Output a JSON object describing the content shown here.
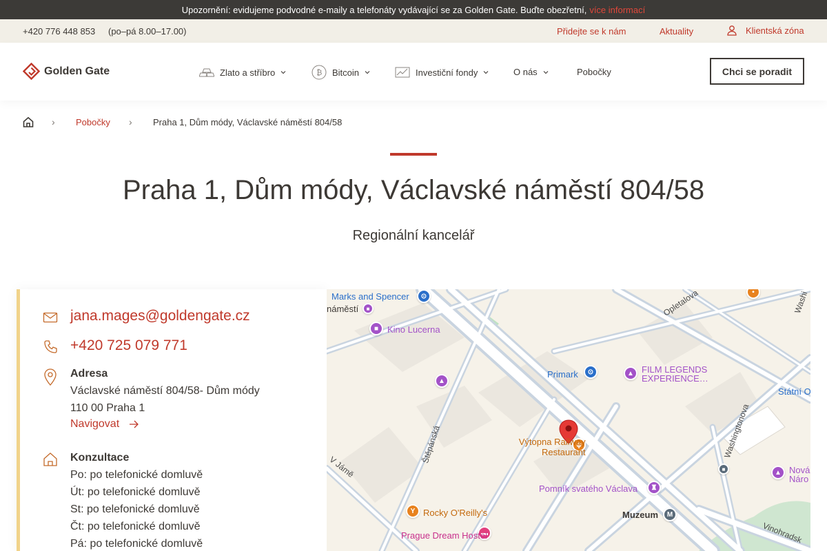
{
  "alert": {
    "text": "Upozornění: evidujeme podvodné e-maily a telefonáty vydávající se za Golden Gate. Buďte obezřetní,",
    "link": "více informací"
  },
  "topbar": {
    "phone": "+420 776 448 853",
    "hours": "(po–pá 8.00–17.00)",
    "join": "Přidejte se k nám",
    "news": "Aktuality",
    "client_zone": "Klientská zóna"
  },
  "header": {
    "logo": "Golden Gate",
    "nav": [
      {
        "label": "Zlato a stříbro"
      },
      {
        "label": "Bitcoin"
      },
      {
        "label": "Investiční fondy"
      },
      {
        "label": "O nás"
      },
      {
        "label": "Pobočky"
      }
    ],
    "cta": "Chci se poradit"
  },
  "breadcrumb": {
    "parent": "Pobočky",
    "current": "Praha 1, Dům módy, Václavské náměstí 804/58"
  },
  "page": {
    "title": "Praha 1, Dům módy, Václavské náměstí 804/58",
    "subtitle": "Regionální kancelář"
  },
  "contact": {
    "email": "jana.mages@goldengate.cz",
    "phone": "+420 725 079 771",
    "address_label": "Adresa",
    "address_line1": "Václavské náměstí 804/58- Dům módy",
    "address_line2": "110 00 Praha 1",
    "navigate": "Navigovat",
    "consult_label": "Konzultace",
    "hours": [
      "Po: po telefonické domluvě",
      "Út: po telefonické domluvě",
      "St: po telefonické domluvě",
      "Čt: po telefonické domluvě",
      "Pá: po telefonické domluvě"
    ]
  },
  "map": {
    "labels": {
      "marks": "Marks and Spencer",
      "namesti": "náměstí",
      "lucerna": "Kino Lucerna",
      "opletalova": "Opletalova",
      "washi": "Washi",
      "primark": "Primark",
      "film1": "FILM LEGENDS",
      "film2": "EXPERIENCE…",
      "statni": "Státní O",
      "vytopna1": "Výtopna Railway",
      "vytopna2": "Restaurant",
      "stepanska": "Štěpánská",
      "vjame": "V Jámě",
      "washingtonova": "Washingtonova",
      "nova1": "Nová",
      "nova2": "Náro",
      "pomnik": "Pomník svatého Václava",
      "muzeum": "Muzeum",
      "metro": "M",
      "rocky": "Rocky O'Reilly's",
      "prague": "Prague Dream Hostel",
      "vinohradska": "Vinohradsk"
    }
  }
}
